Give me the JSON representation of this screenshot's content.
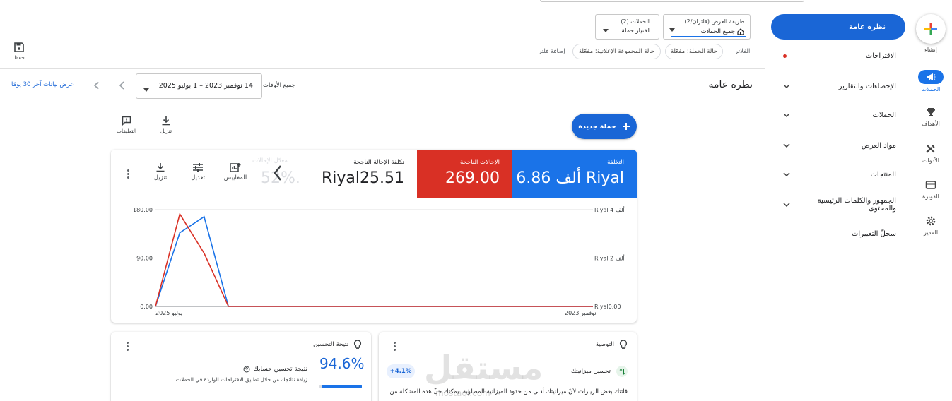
{
  "rail": {
    "create_label": "إنشاء",
    "items": [
      {
        "label": "الحملات",
        "icon": "megaphone-icon"
      },
      {
        "label": "الأهداف",
        "icon": "trophy-icon"
      },
      {
        "label": "الأدوات",
        "icon": "tools-icon"
      },
      {
        "label": "الفوترة",
        "icon": "credit-card-icon"
      },
      {
        "label": "المدير",
        "icon": "gear-icon"
      }
    ]
  },
  "nav": {
    "overview": "نظرة عامة",
    "items": [
      "الاقتراحات",
      "الإحصاءات والتقارير",
      "الحملات",
      "مواد العرض",
      "المنتجات",
      "الجمهور والكلمات الرئيسية والمحتوى",
      "سجلّ التغييرات"
    ]
  },
  "filters": {
    "view_mode_title": "طريقة العرض (فلتران/2)",
    "view_mode_value": "جميع الحملات",
    "campaigns_title": "الحملات (2)",
    "campaigns_value": "اختيار حملة",
    "filters_label": "الفلاتر",
    "chip_campaign_status": "حالة الحملة: مفعّلة",
    "chip_adgroup_status": "حالة المجموعة الإعلانية: مفعّلة",
    "add_filter": "إضافة فلتر",
    "save_label": "حفظ"
  },
  "header": {
    "title": "نظرة عامة",
    "all_times": "جميع الأوقات",
    "date_range": "14 نوفمبر 2023 – 1 يوليو 2025",
    "show_last_30": "عرض بيانات آخر 30 يومًا"
  },
  "actions": {
    "new_campaign": "حملة جديدة",
    "download": "تنزيل",
    "feedback": "التعليقات"
  },
  "metrics": {
    "cost_label": "التكلفة",
    "cost_value": "6.86 ألف Riyal",
    "conv_label": "الإحالات الناجحة",
    "conv_value": "269.00",
    "cpc_label": "تكلفة الإحالة الناجحة",
    "cpc_value": "Riyal25.51",
    "faded_label": "معدّل الإحالات",
    "faded_value": ".52%",
    "tool_metrics": "المقاييس",
    "tool_adjust": "تعديل",
    "tool_download": "تنزيل"
  },
  "chart_data": {
    "type": "line",
    "x_start_label": "يوليو 2025",
    "x_end_label": "نوفمبر 2023",
    "left_axis_ticks": [
      "180.00",
      "90.00",
      "0.00"
    ],
    "right_axis_ticks": [
      "Riyal 4 ألف",
      "Riyal 2 ألف",
      "Riyal0.00"
    ],
    "left_ylim": [
      0,
      180
    ],
    "right_ylim": [
      0,
      4
    ],
    "grid": true,
    "series": [
      {
        "color": "#1a73e8",
        "axis": "left",
        "values": [
          0,
          137,
          167,
          0,
          0,
          0,
          0,
          0,
          0,
          0,
          0,
          0,
          0,
          0,
          0,
          0,
          0,
          0,
          0
        ]
      },
      {
        "color": "#d93025",
        "axis": "left",
        "values": [
          0,
          172,
          99,
          0,
          0,
          0,
          0,
          0,
          0,
          0,
          0,
          0,
          0,
          0,
          0,
          0,
          0,
          0,
          0
        ]
      }
    ]
  },
  "recommendation": {
    "title": "التوصية",
    "subtitle": "تحسين ميزانيتك",
    "badge": "+4.1%",
    "body": "فاتتك بعض الزيارات لأنّ ميزانيتك أدنى من حدود الميزانية المطلوبة. يمكنك حلّ هذه المشكلة من"
  },
  "optimization": {
    "title": "نتيجة التحسين",
    "score": "94.6%",
    "score_fraction": 0.946,
    "heading": "نتيجة تحسين حسابك",
    "desc": "زيادة نتائجك من خلال تطبيق الاقتراحات الواردة في الحملات"
  },
  "watermark": "مستقل",
  "watermark_sub": "mostaql.com",
  "colors": {
    "primary": "#1a73e8",
    "cost_card": "#1a73e8",
    "conv_card": "#d93025"
  }
}
